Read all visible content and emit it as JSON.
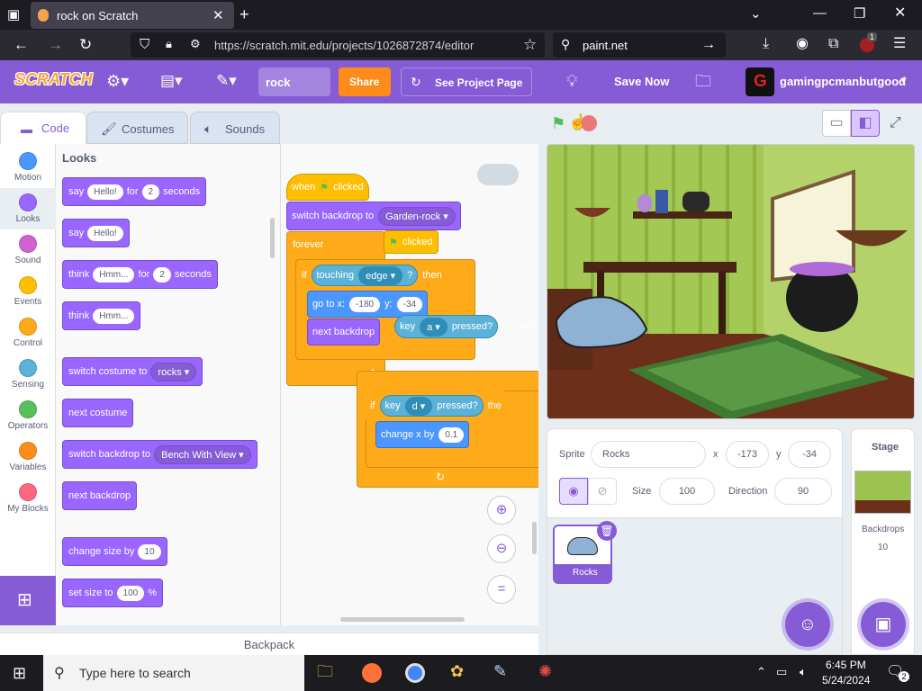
{
  "browser": {
    "tab_title": "rock on Scratch",
    "url": "https://scratch.mit.edu/projects/1026872874/editor",
    "search_text": "paint.net",
    "extension_badge": "1"
  },
  "menu": {
    "logo": "SCRATCH",
    "project_title": "rock",
    "share_label": "Share",
    "see_project_label": "See Project Page",
    "save_label": "Save Now",
    "username": "gamingpcmanbutgood",
    "avatar_letter": "G"
  },
  "editor_tabs": [
    "Code",
    "Costumes",
    "Sounds"
  ],
  "categories": [
    {
      "label": "Motion",
      "color": "#4c97ff"
    },
    {
      "label": "Looks",
      "color": "#9966ff"
    },
    {
      "label": "Sound",
      "color": "#cf63cf"
    },
    {
      "label": "Events",
      "color": "#ffbf00"
    },
    {
      "label": "Control",
      "color": "#ffab19"
    },
    {
      "label": "Sensing",
      "color": "#5cb1d6"
    },
    {
      "label": "Operators",
      "color": "#59c059"
    },
    {
      "label": "Variables",
      "color": "#ff8c1a"
    },
    {
      "label": "My Blocks",
      "color": "#ff6680"
    }
  ],
  "palette": {
    "heading": "Looks",
    "b1": {
      "say": "say",
      "val": "Hello!",
      "for": "for",
      "n": "2",
      "sec": "seconds"
    },
    "b2": {
      "say": "say",
      "val": "Hello!"
    },
    "b3": {
      "think": "think",
      "val": "Hmm...",
      "for": "for",
      "n": "2",
      "sec": "seconds"
    },
    "b4": {
      "think": "think",
      "val": "Hmm..."
    },
    "b5": {
      "text": "switch costume to",
      "val": "rocks"
    },
    "b6": {
      "text": "next costume"
    },
    "b7": {
      "text": "switch backdrop to",
      "val": "Bench With View"
    },
    "b8": {
      "text": "next backdrop"
    },
    "b9": {
      "text": "change size by",
      "val": "10"
    },
    "b10": {
      "text": "set size to",
      "val": "100",
      "unit": "%"
    }
  },
  "script": {
    "when": "when",
    "clicked": "clicked",
    "clicked2": "clicked",
    "switch_backdrop": "switch backdrop to",
    "backdrop_val": "Garden-rock",
    "forever": "forever",
    "if": "if",
    "touching": "touching",
    "touching_val": "edge",
    "q": "?",
    "then": "then",
    "goto": "go to x:",
    "gx": "-180",
    "y": "y:",
    "gy": "-34",
    "next_backdrop": "next backdrop",
    "key": "key",
    "key_a": "a",
    "pressed": "pressed?",
    "the": "the",
    "if2": "if",
    "key2": "key",
    "key_d": "d",
    "pressed2": "pressed?",
    "the2": "the",
    "change_x": "change x by",
    "cx": "0.1"
  },
  "sprite_panel": {
    "sprite_label": "Sprite",
    "sprite_name": "Rocks",
    "x_label": "x",
    "x": "-173",
    "y_label": "y",
    "y": "-34",
    "size_label": "Size",
    "size": "100",
    "direction_label": "Direction",
    "direction": "90",
    "sprite_thumb_label": "Rocks"
  },
  "stage_panel": {
    "label": "Stage",
    "backdrops_label": "Backdrops",
    "backdrops_count": "10"
  },
  "backpack": "Backpack",
  "taskbar": {
    "search_placeholder": "Type here to search",
    "time": "6:45 PM",
    "date": "5/24/2024",
    "notif": "2"
  }
}
